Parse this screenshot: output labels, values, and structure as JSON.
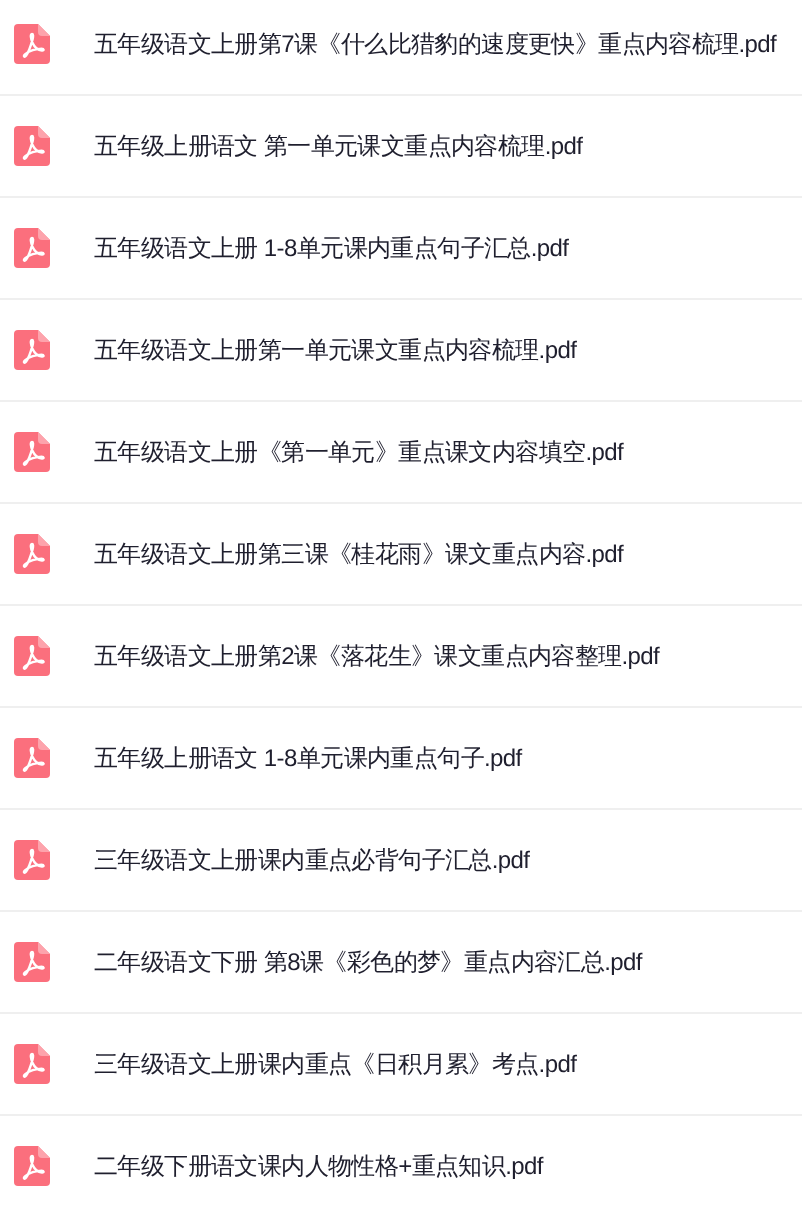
{
  "files": [
    {
      "name": "五年级语文上册第7课《什么比猎豹的速度更快》重点内容梳理.pdf"
    },
    {
      "name": "五年级上册语文 第一单元课文重点内容梳理.pdf"
    },
    {
      "name": "五年级语文上册 1-8单元课内重点句子汇总.pdf"
    },
    {
      "name": "五年级语文上册第一单元课文重点内容梳理.pdf"
    },
    {
      "name": "五年级语文上册《第一单元》重点课文内容填空.pdf"
    },
    {
      "name": "五年级语文上册第三课《桂花雨》课文重点内容.pdf"
    },
    {
      "name": "五年级语文上册第2课《落花生》课文重点内容整理.pdf"
    },
    {
      "name": "五年级上册语文 1-8单元课内重点句子.pdf"
    },
    {
      "name": "三年级语文上册课内重点必背句子汇总.pdf"
    },
    {
      "name": "二年级语文下册 第8课《彩色的梦》重点内容汇总.pdf"
    },
    {
      "name": "三年级语文上册课内重点《日积月累》考点.pdf"
    },
    {
      "name": "二年级下册语文课内人物性格+重点知识.pdf"
    }
  ]
}
